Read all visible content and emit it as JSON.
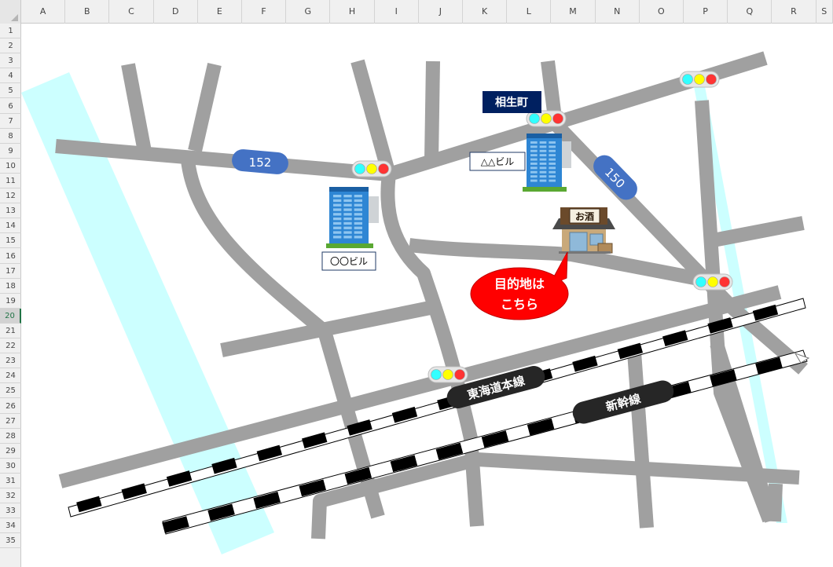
{
  "spreadsheet": {
    "columns": [
      "A",
      "B",
      "C",
      "D",
      "E",
      "F",
      "G",
      "H",
      "I",
      "J",
      "K",
      "L",
      "M",
      "N",
      "O",
      "P",
      "Q",
      "R",
      "S"
    ],
    "rows": [
      "1",
      "2",
      "3",
      "4",
      "5",
      "6",
      "7",
      "8",
      "9",
      "10",
      "11",
      "12",
      "13",
      "14",
      "15",
      "16",
      "17",
      "18",
      "19",
      "20",
      "21",
      "22",
      "23",
      "24",
      "25",
      "26",
      "27",
      "28",
      "29",
      "30",
      "31",
      "32",
      "33",
      "34",
      "35"
    ],
    "active_row": "20"
  },
  "map": {
    "route_152": "152",
    "route_150": "150",
    "place_aioicho": "相生町",
    "building_maru": "〇〇ビル",
    "building_sankaku": "△△ビル",
    "shop_sign": "お酒",
    "destination_line1": "目的地は",
    "destination_line2": "こちら",
    "rail_tokaido": "東海道本線",
    "rail_shinkansen": "新幹線"
  },
  "colors": {
    "road": "#a0a0a0",
    "river": "#ccffff",
    "route_shield": "#4472c4",
    "place_label_bg": "#002060",
    "destination_bubble": "#ff0000",
    "rail_label_bg": "#262626",
    "signal_cyan": "#33ffff",
    "signal_yellow": "#ffff00",
    "signal_red": "#ff3333"
  }
}
